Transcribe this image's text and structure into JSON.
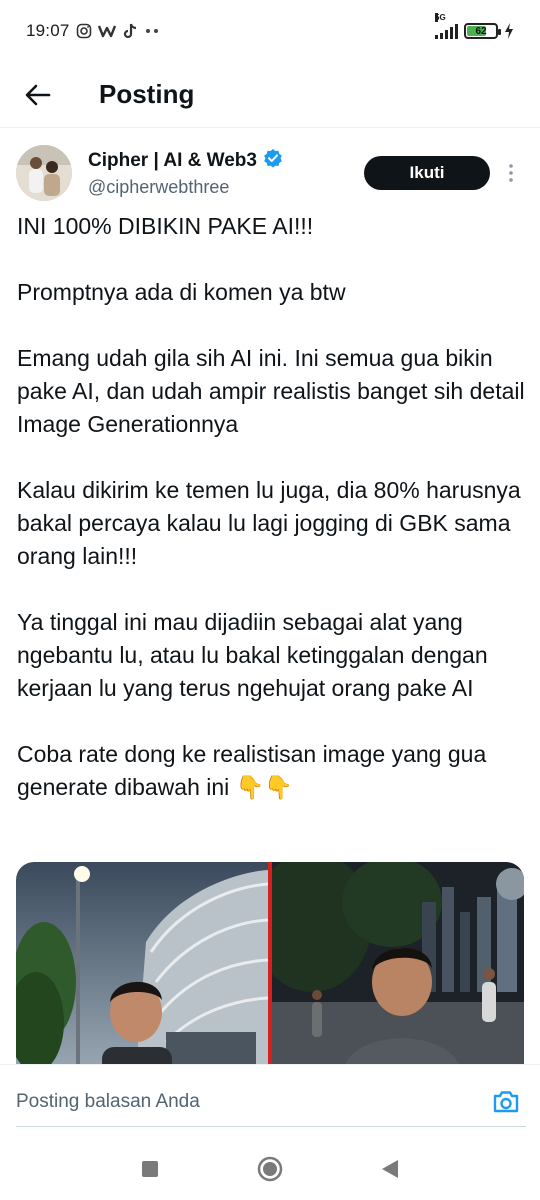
{
  "status_bar": {
    "time": "19:07",
    "network": "5G",
    "battery": "62"
  },
  "header": {
    "title": "Posting"
  },
  "post": {
    "author": {
      "display_name": "Cipher | AI & Web3",
      "handle": "@cipherwebthree"
    },
    "follow_label": "Ikuti",
    "paragraphs": [
      "INI 100% DIBIKIN PAKE AI!!!",
      "Promptnya ada di komen ya btw",
      "Emang udah gila sih AI ini. Ini semua gua bikin pake AI, dan udah ampir realistis banget sih detail Image Generationnya",
      "Kalau dikirim ke temen lu juga, dia 80% harusnya bakal percaya kalau lu lagi jogging di GBK sama orang lain!!!",
      "Ya tinggal ini mau dijadiin sebagai alat yang ngebantu lu, atau lu bakal ketinggalan dengan kerjaan lu yang terus ngehujat orang pake AI",
      "Coba rate dong ke realistisan image yang gua generate dibawah ini 👇👇"
    ]
  },
  "reply": {
    "placeholder": "Posting balasan Anda"
  },
  "colors": {
    "text": "#0f1419",
    "secondary": "#536471",
    "verified": "#1d9bf0",
    "divider_red": "#d61f1f"
  }
}
